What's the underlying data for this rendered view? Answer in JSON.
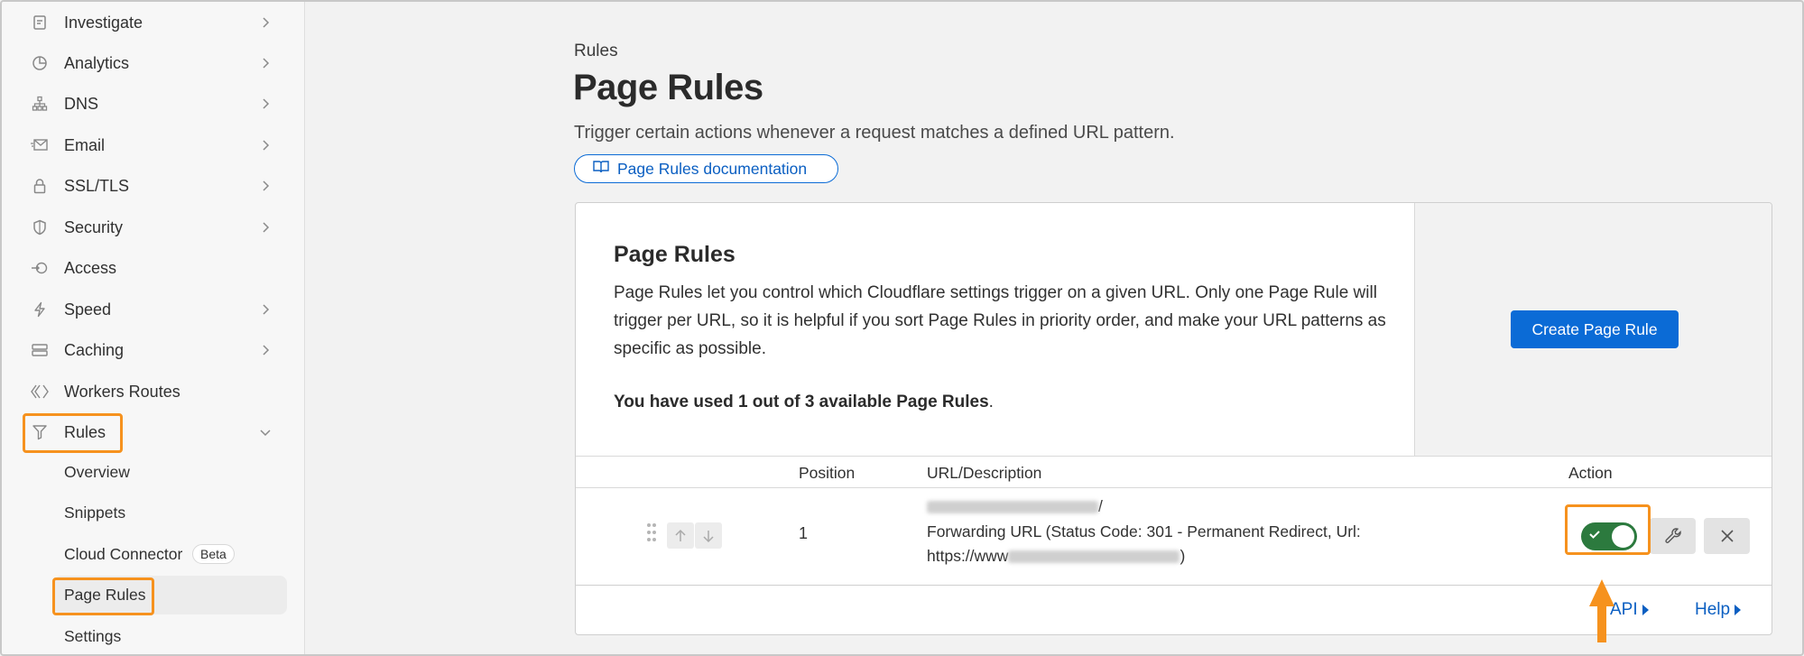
{
  "sidebar": {
    "items": [
      {
        "label": "Investigate",
        "icon": "investigate-icon",
        "chevron": "right"
      },
      {
        "label": "Analytics",
        "icon": "analytics-icon",
        "chevron": "right"
      },
      {
        "label": "DNS",
        "icon": "dns-icon",
        "chevron": "right"
      },
      {
        "label": "Email",
        "icon": "email-icon",
        "chevron": "right"
      },
      {
        "label": "SSL/TLS",
        "icon": "lock-icon",
        "chevron": "right"
      },
      {
        "label": "Security",
        "icon": "shield-icon",
        "chevron": "right"
      },
      {
        "label": "Access",
        "icon": "access-icon",
        "chevron": ""
      },
      {
        "label": "Speed",
        "icon": "lightning-icon",
        "chevron": "right"
      },
      {
        "label": "Caching",
        "icon": "caching-icon",
        "chevron": "right"
      },
      {
        "label": "Workers Routes",
        "icon": "workers-icon",
        "chevron": ""
      },
      {
        "label": "Rules",
        "icon": "rules-icon",
        "chevron": "down"
      }
    ],
    "sub_items": [
      {
        "label": "Overview"
      },
      {
        "label": "Snippets"
      },
      {
        "label": "Cloud Connector",
        "badge": "Beta"
      },
      {
        "label": "Page Rules"
      },
      {
        "label": "Settings"
      }
    ]
  },
  "header": {
    "breadcrumb": "Rules",
    "title": "Page Rules",
    "description": "Trigger certain actions whenever a request matches a defined URL pattern.",
    "doc_link": "Page Rules documentation"
  },
  "info": {
    "title": "Page Rules",
    "text": "Page Rules let you control which Cloudflare settings trigger on a given URL. Only one Page Rule will trigger per URL, so it is helpful if you sort Page Rules in priority order, and make your URL patterns as specific as possible.",
    "usage_bold": "You have used 1 out of 3 available Page Rules",
    "usage_end": ".",
    "create_button": "Create Page Rule"
  },
  "table": {
    "headers": {
      "position": "Position",
      "url": "URL/Description",
      "action": "Action"
    },
    "rows": [
      {
        "position": "1",
        "url_suffix": "/",
        "desc_line1": "Forwarding URL (Status Code: 301 - Permanent Redirect, Url:",
        "desc_line2_prefix": "https://www",
        "desc_line2_suffix": ")",
        "enabled": true
      }
    ]
  },
  "footer": {
    "api_link": "API",
    "help_link": "Help"
  },
  "colors": {
    "accent": "#0b6bd6",
    "highlight": "#f6921e",
    "toggle_on": "#2c7a3e"
  }
}
